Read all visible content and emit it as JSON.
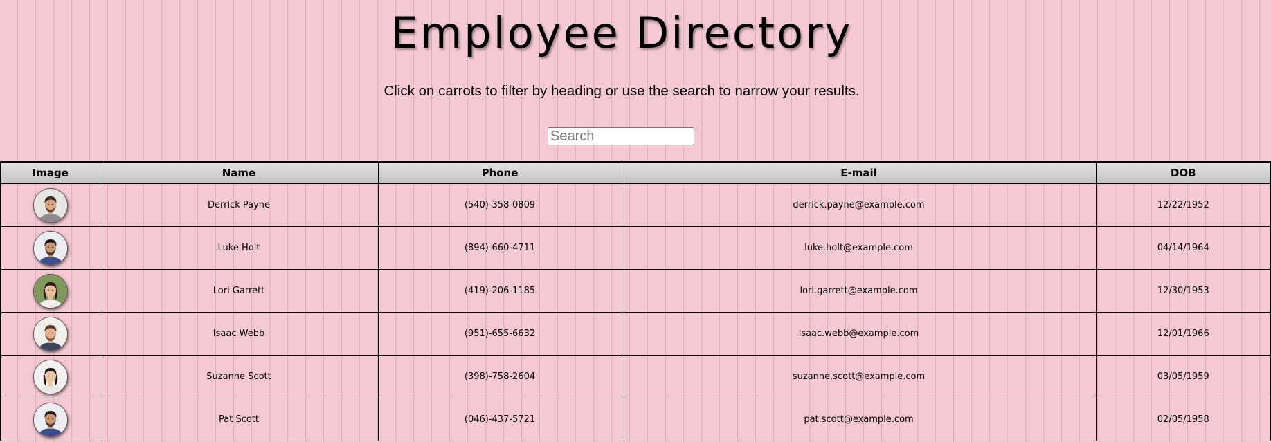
{
  "header": {
    "title": "Employee Directory",
    "subtitle": "Click on carrots to filter by heading or use the search to narrow your results."
  },
  "search": {
    "placeholder": "Search",
    "value": ""
  },
  "table": {
    "columns": [
      "Image",
      "Name",
      "Phone",
      "E-mail",
      "DOB"
    ],
    "rows": [
      {
        "name": "Derrick Payne",
        "phone": "(540)-358-0809",
        "email": "derrick.payne@example.com",
        "dob": "12/22/1952",
        "avatar": {
          "bg": "#e6e6e3",
          "skin": "#d9a684",
          "hair": "#3a2a20",
          "shirt": "#8a8c90",
          "beard": true
        }
      },
      {
        "name": "Luke Holt",
        "phone": "(894)-660-4711",
        "email": "luke.holt@example.com",
        "dob": "04/14/1964",
        "avatar": {
          "bg": "#ecedf2",
          "skin": "#c99672",
          "hair": "#1f1a17",
          "shirt": "#3b4d8a",
          "beard": true
        }
      },
      {
        "name": "Lori Garrett",
        "phone": "(419)-206-1185",
        "email": "lori.garrett@example.com",
        "dob": "12/30/1953",
        "avatar": {
          "bg": "#7f9a5c",
          "skin": "#e6bb98",
          "hair": "#2a1d16",
          "shirt": "#f2f0ec",
          "beard": false
        }
      },
      {
        "name": "Isaac Webb",
        "phone": "(951)-655-6632",
        "email": "isaac.webb@example.com",
        "dob": "12/01/1966",
        "avatar": {
          "bg": "#f1efec",
          "skin": "#e2b08f",
          "hair": "#5b3e2c",
          "shirt": "#3b4660",
          "beard": true
        }
      },
      {
        "name": "Suzanne Scott",
        "phone": "(398)-758-2604",
        "email": "suzanne.scott@example.com",
        "dob": "03/05/1959",
        "avatar": {
          "bg": "#f1f1ef",
          "skin": "#ebc5a6",
          "hair": "#1c1714",
          "shirt": "#e8e8e5",
          "beard": false
        }
      },
      {
        "name": "Pat Scott",
        "phone": "(046)-437-5721",
        "email": "pat.scott@example.com",
        "dob": "02/05/1958",
        "avatar": {
          "bg": "#ecedf2",
          "skin": "#c99672",
          "hair": "#1f1a17",
          "shirt": "#3b4d8a",
          "beard": true
        }
      }
    ]
  },
  "colors": {
    "page_background": "#f4c9d4",
    "header_background": "#d0d0d0",
    "border": "#000000"
  }
}
